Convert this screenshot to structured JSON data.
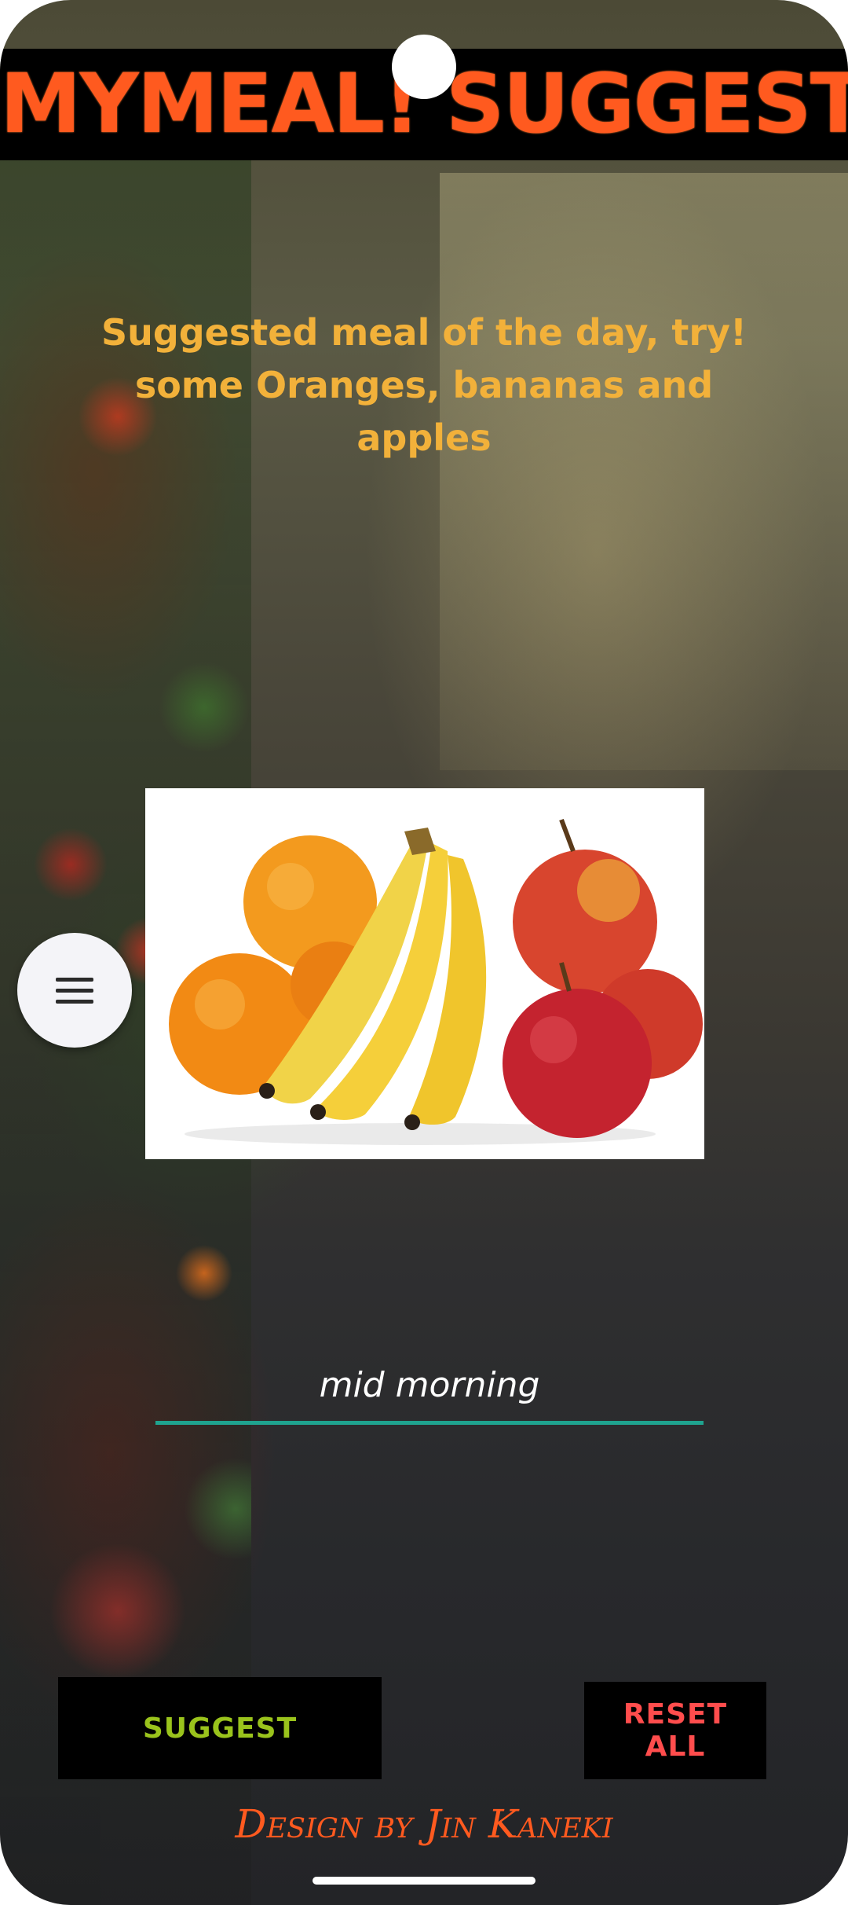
{
  "header": {
    "title": "MYMEAL! SUGGESTOR"
  },
  "main": {
    "suggestion_text": "Suggested meal of the day, try! some Oranges, bananas and apples",
    "image_subject": "oranges, bananas and apples",
    "menu_icon": "hamburger-menu-icon",
    "meal_time_value": "mid morning"
  },
  "actions": {
    "suggest_label": "SUGGEST",
    "reset_label": "RESET ALL"
  },
  "footer": {
    "credit": "Design by Jin Kaneki"
  },
  "colors": {
    "title": "#ff5a1f",
    "suggestion_text": "#f2b13a",
    "input_underline": "#1fa38f",
    "suggest_button_text": "#9ac31c",
    "reset_button_text": "#ff4d4d",
    "button_bg": "#000000"
  }
}
